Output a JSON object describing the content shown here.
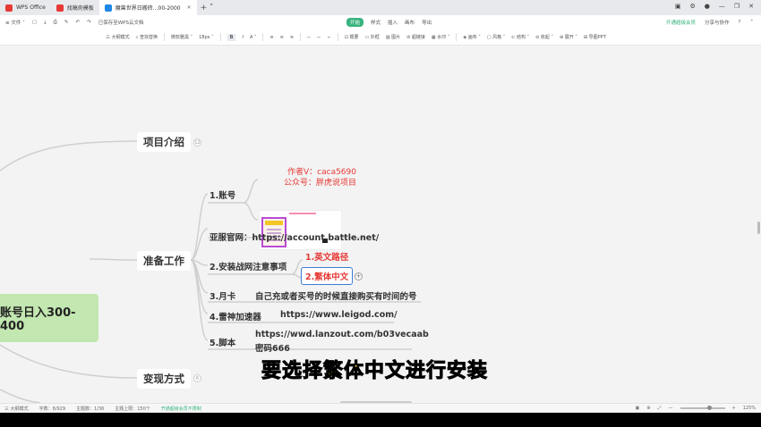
{
  "tabs": [
    {
      "label": "WPS Office",
      "color": "#e53935",
      "active": false
    },
    {
      "label": "找稿壳模板",
      "color": "#e53935",
      "active": false
    },
    {
      "label": "魔兽世界日搬砖...00-2000",
      "color": "#1e88e5",
      "active": true
    }
  ],
  "window_controls": [
    "▣",
    "⚙",
    "●",
    "—",
    "❐",
    "✕"
  ],
  "menubar": {
    "file": "≡ 文件 ˅",
    "save_note": "已保存至WPS云文档",
    "menus": [
      "开始",
      "样式",
      "插入",
      "画布",
      "导出"
    ],
    "active_menu": "开始",
    "right": [
      "开通超级会员",
      "分享与协作",
      "?",
      "⌃"
    ]
  },
  "toolbar": [
    "三 大纲模式",
    "⌕ 查找替换",
    "|",
    "微软雅黑 ˅",
    "18px ˅",
    "|",
    "B",
    "I",
    "A ˅",
    "|",
    "≡",
    "≡",
    "≡",
    "|",
    "⌐",
    "⌐",
    "⌐",
    "|",
    "⊡ 概要",
    "▭ 外框",
    "▨ 图片",
    "⊘ 超链接",
    "▦ 水印 ˅",
    "|",
    "◈ 画布 ˅",
    "▢ 风格 ˅",
    "⊏ 结构 ˅",
    "⊖ 收起 ˅",
    "⊕ 展开 ˅",
    "⊞ 导图PPT"
  ],
  "mindmap": {
    "root": "账号日入300-400",
    "branches": {
      "intro": "项目介绍",
      "prep": "准备工作",
      "monetize": "变现方式"
    },
    "prep_children": {
      "account": "1.账号",
      "asia_site": "亚服官网：https://account.battle.net/",
      "install": "2.安装战网注意事项",
      "path_en": "1.英文路径",
      "trad_cn": "2.繁体中文",
      "month_card": "3.月卡",
      "month_card_note": "自己充或者买号的时候直接购买有时间的号",
      "accelerator": "4.雷神加速器",
      "accelerator_url": "https://www.leigod.com/",
      "script": "5.脚本",
      "script_url": "https://wwd.lanzout.com/b03vecaab",
      "script_pwd": "密码666"
    },
    "fold_counts": {
      "intro": "12",
      "monetize": "6"
    }
  },
  "watermark": {
    "author": "作者V：caca5690",
    "public": "公众号：胖虎说项目"
  },
  "subtitle": "要选择繁体中文进行安装",
  "statusbar": {
    "outline": "三 大纲模式",
    "words": "字数：6/929",
    "topics": "主题数：1/36",
    "limit": "主题上限：150个",
    "upgrade": "开通超级会员不限制",
    "zoom": "125%"
  }
}
